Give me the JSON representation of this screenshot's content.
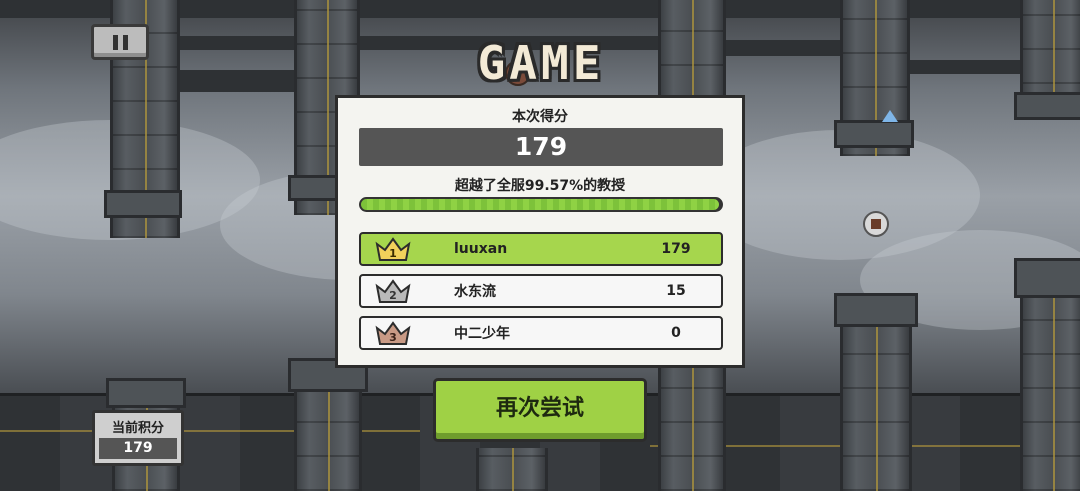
{
  "pause_button": {
    "icon": "pause-icon"
  },
  "title": "GAME OVER",
  "result": {
    "score_label": "本次得分",
    "score_value": "179",
    "beat_text": "超越了全服99.57%的教授",
    "progress_fraction": 0.9957
  },
  "leaderboard": [
    {
      "rank": "1",
      "name": "luuxan",
      "score": "179",
      "crown_color": "#f2d15b"
    },
    {
      "rank": "2",
      "name": "水东流",
      "score": "15",
      "crown_color": "#b9b9b9"
    },
    {
      "rank": "3",
      "name": "中二少年",
      "score": "0",
      "crown_color": "#c99a85"
    }
  ],
  "retry_label": "再次尝试",
  "current_score": {
    "label": "当前积分",
    "value": "179"
  },
  "colors": {
    "accent_green": "#a6d64d",
    "panel_bg": "#f4f4f0",
    "dark_box": "#555555"
  }
}
